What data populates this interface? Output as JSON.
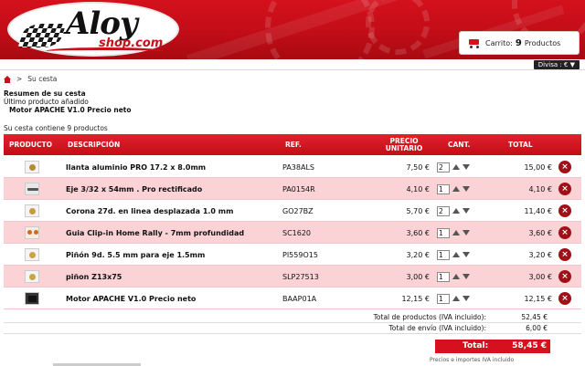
{
  "header": {
    "logo_main": "Aloy",
    "logo_sub": "shop.com",
    "cart_label": "Carrito:",
    "cart_count": "9",
    "cart_unit": "Productos",
    "currency_label": "Divisa : € ▼"
  },
  "breadcrumb": {
    "current": "Su cesta",
    "separator": ">"
  },
  "summary": {
    "title": "Resumen de su cesta",
    "last_added_label": "Último producto añadido",
    "last_added_product": "Motor APACHE V1.0 Precio neto",
    "count_text": "Su cesta contiene 9 productos"
  },
  "table": {
    "headers": {
      "product": "PRODUCTO",
      "description": "DESCRIPCIÓN",
      "ref": "REF.",
      "unit_price_1": "PRECIO",
      "unit_price_2": "UNITARIO",
      "qty": "CANT.",
      "total": "TOTAL"
    },
    "rows": [
      {
        "desc": "llanta aluminio PRO 17.2 x 8.0mm",
        "ref": "PA38ALS",
        "unit": "7,50 €",
        "qty": "2",
        "total": "15,00 €"
      },
      {
        "desc": "Eje 3/32 x 54mm . Pro rectificado",
        "ref": "PA0154R",
        "unit": "4,10 €",
        "qty": "1",
        "total": "4,10 €"
      },
      {
        "desc": "Corona 27d. en linea desplazada 1.0 mm",
        "ref": "GO27BZ",
        "unit": "5,70 €",
        "qty": "2",
        "total": "11,40 €"
      },
      {
        "desc": "Guia Clip-in Home Rally - 7mm profundidad",
        "ref": "SC1620",
        "unit": "3,60 €",
        "qty": "1",
        "total": "3,60 €"
      },
      {
        "desc": "Piñón 9d. 5.5 mm para eje 1.5mm",
        "ref": "PI559O15",
        "unit": "3,20 €",
        "qty": "1",
        "total": "3,20 €"
      },
      {
        "desc": "piñon Z13x75",
        "ref": "SLP27513",
        "unit": "3,00 €",
        "qty": "1",
        "total": "3,00 €"
      },
      {
        "desc": "Motor APACHE V1.0 Precio neto",
        "ref": "BAAP01A",
        "unit": "12,15 €",
        "qty": "1",
        "total": "12,15 €"
      }
    ]
  },
  "totals": {
    "products_label": "Total de productos (IVA incluido):",
    "products_value": "52,45 €",
    "shipping_label": "Total de envío (IVA incluido):",
    "shipping_value": "6,00 €",
    "grand_label": "Total:",
    "grand_value": "58,45 €",
    "note": "Precios e importes IVA incluido"
  },
  "colors": {
    "brand_red": "#d4111c",
    "row_pink": "#fbd2d5"
  }
}
